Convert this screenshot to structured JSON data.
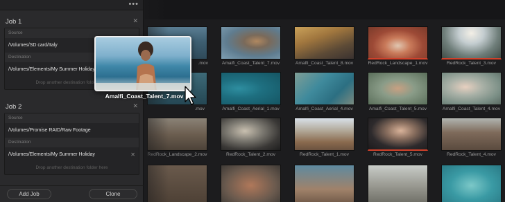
{
  "panel": {
    "jobs": [
      {
        "title": "Job 1",
        "source_label": "Source",
        "source_path": "/Volumes/SD card/Italy",
        "destination_label": "Destination",
        "destination_path": "/Volumes/Elements/My Summer Holiday",
        "drop_hint": "Drop another destination folder here"
      },
      {
        "title": "Job 2",
        "source_label": "Source",
        "source_path": "/Volumes/Promise RAID/Raw Footage",
        "destination_label": "Destination",
        "destination_path": "/Volumes/Elements/My Summer Holiday",
        "drop_hint": "Drop another destination folder here"
      }
    ],
    "add_job_label": "Add Job",
    "clone_label": "Clone",
    "menu_icon": "more-dots-icon",
    "close_icon": "close-icon"
  },
  "clips": {
    "row1": [
      "",
      "Amalfi_Coast_Talent_7.mov",
      "Amalfi_Coast_Talent_8.mov",
      "RedRock_Landscape_1.mov",
      "RedRock_Talent_3.mov"
    ],
    "row2": [
      "",
      "Amalfi_Coast_Aerial_1.mov",
      "Amalfi_Coast_Aerial_4.mov",
      "Amalfi_Coast_Talent_5.mov",
      "Amalfi_Coast_Talent_4.mov"
    ],
    "row3": [
      "RedRock_Landscape_2.mov",
      "RedRock_Talent_2.mov",
      "RedRock_Talent_1.mov",
      "RedRock_Talent_5.mov",
      "RedRock_Talent_4.mov"
    ],
    "row2_first_partial": ".mov",
    "row1_first_partial": ".mov"
  },
  "drag": {
    "filename": "Amalfi_Coast_Talent_7.mov"
  },
  "colors": {
    "panel_bg": "#2a2a2c",
    "grid_bg": "#1c1c1e",
    "selection_border": "#efefef"
  }
}
